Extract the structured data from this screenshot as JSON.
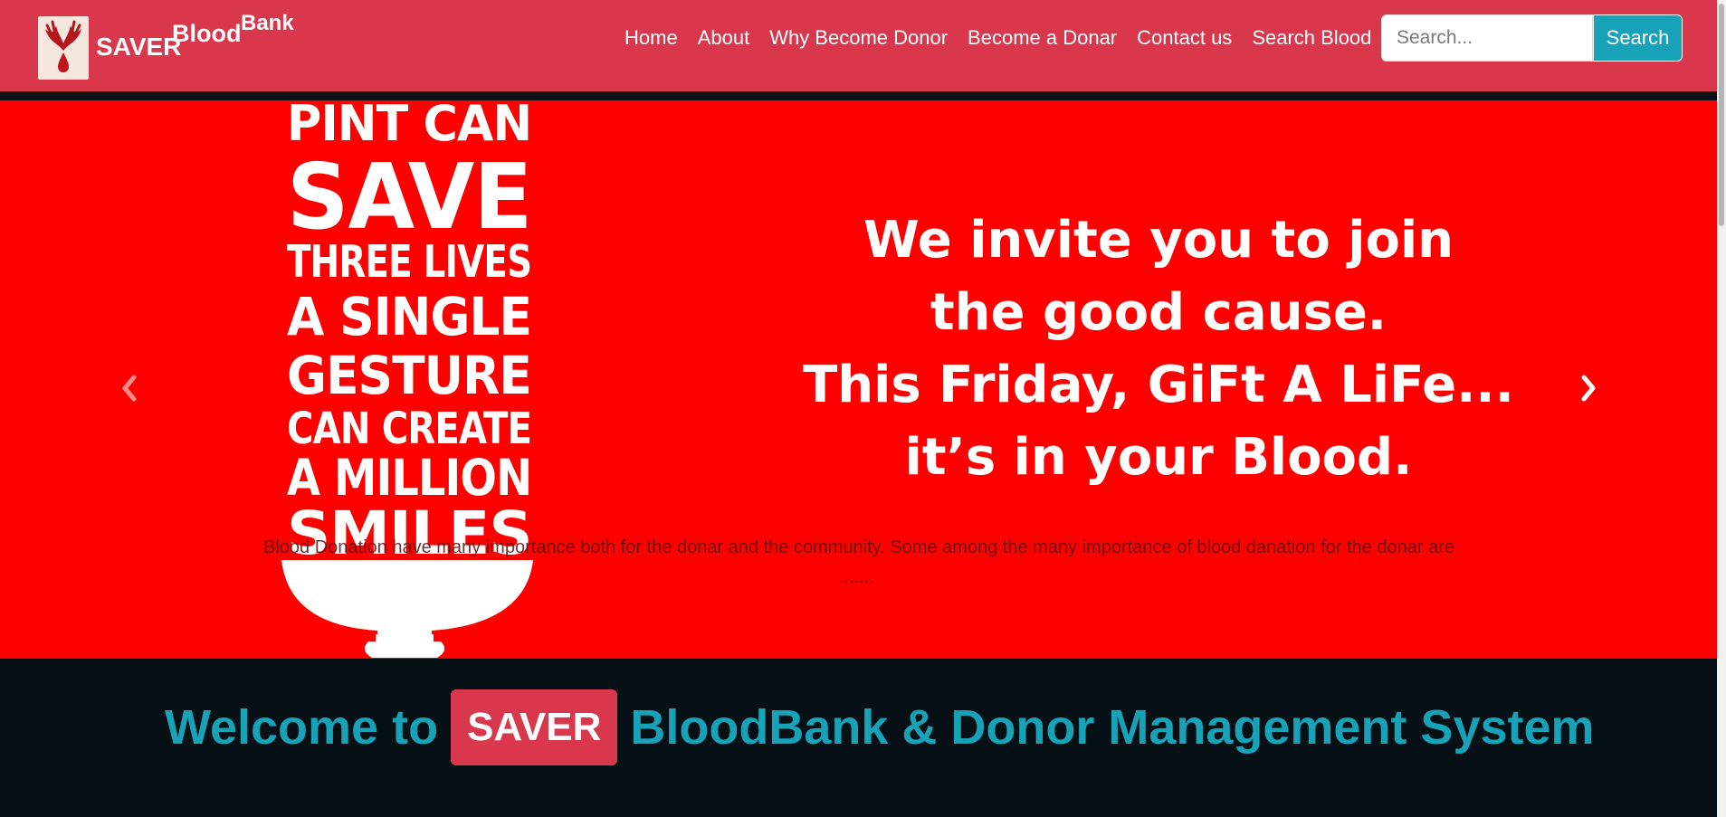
{
  "brand": {
    "part1": "SAVER",
    "part2": "Blood",
    "part3": "Bank",
    "logo_icon": "blood-drop-hands-icon"
  },
  "nav": {
    "items": [
      {
        "label": "Home"
      },
      {
        "label": "About"
      },
      {
        "label": "Why Become Donor"
      },
      {
        "label": "Become a Donar"
      },
      {
        "label": "Contact us"
      },
      {
        "label": "Search Blood"
      }
    ]
  },
  "search": {
    "placeholder": "Search...",
    "value": "",
    "button_label": "Search"
  },
  "carousel": {
    "poster_left_lines": [
      "PINT CAN",
      "SAVE",
      "THREE LIVES",
      "A SINGLE",
      "GESTURE",
      "CAN CREATE",
      "A MILLION",
      "SMILES"
    ],
    "poster_right_lines": [
      "We invite you to join",
      "the good cause.",
      "This Friday, GiFt A LiFe...",
      "it’s in your Blood."
    ],
    "caption": "Blood Donation have many importance both for the donar and the community. Some among the many importance of blood danation for the donar are ......",
    "prev_icon": "chevron-left-icon",
    "next_icon": "chevron-right-icon"
  },
  "welcome": {
    "prefix": "Welcome to",
    "badge": "SAVER",
    "suffix": "BloodBank & Donor Management System"
  },
  "colors": {
    "navbar": "#d9374b",
    "accent": "#17a2b8",
    "slide_bg": "#ff0000",
    "dark_bg": "#061015"
  }
}
